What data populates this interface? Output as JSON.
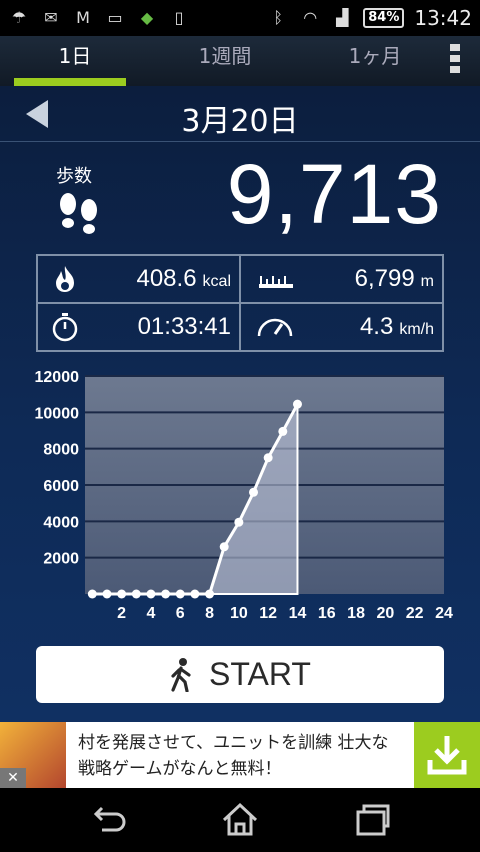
{
  "status_bar": {
    "battery": "84%",
    "time": "13:42"
  },
  "tabs": [
    {
      "label": "1日",
      "active": true
    },
    {
      "label": "1週間",
      "active": false
    },
    {
      "label": "1ヶ月",
      "active": false
    }
  ],
  "date": "3月20日",
  "steps": {
    "label": "歩数",
    "value": "9,713"
  },
  "stats": {
    "calories": {
      "value": "408.6",
      "unit": "kcal"
    },
    "distance": {
      "value": "6,799",
      "unit": "m"
    },
    "time": {
      "value": "01:33:41"
    },
    "speed": {
      "value": "4.3",
      "unit": "km/h"
    }
  },
  "start_button": {
    "label": "START"
  },
  "ad": {
    "line1": "村を発展させて、ユニットを訓練 壮大な",
    "line2": "戦略ゲームがなんと無料！"
  },
  "colors": {
    "accent": "#9ccc1f",
    "background": "#0e2a56"
  },
  "chart_data": {
    "type": "area",
    "x": [
      0,
      1,
      2,
      3,
      4,
      5,
      6,
      7,
      8,
      9,
      10,
      11,
      12,
      13,
      14
    ],
    "y": [
      0,
      0,
      0,
      0,
      0,
      0,
      0,
      0,
      0,
      2600,
      3950,
      5600,
      7500,
      8950,
      10450
    ],
    "x_ticks": [
      "2",
      "4",
      "6",
      "8",
      "10",
      "12",
      "14",
      "16",
      "18",
      "20",
      "22",
      "24"
    ],
    "y_ticks": [
      "2000",
      "4000",
      "6000",
      "8000",
      "10000",
      "12000"
    ],
    "xlim": [
      -0.5,
      24
    ],
    "ylim": [
      0,
      12000
    ],
    "grid": true
  }
}
